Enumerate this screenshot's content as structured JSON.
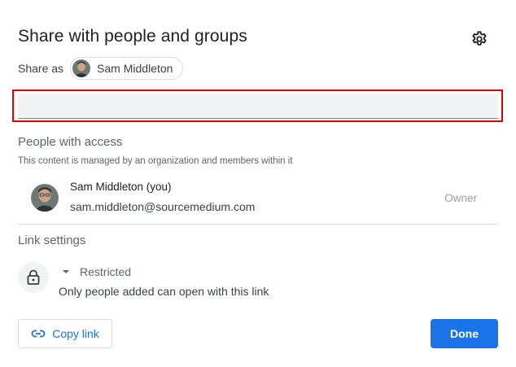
{
  "dialog": {
    "title": "Share with people and groups",
    "settings_icon": "gear-icon"
  },
  "share_as": {
    "label": "Share as",
    "account_name": "Sam Middleton"
  },
  "add_people_input": {
    "value": "",
    "placeholder": ""
  },
  "people_with_access": {
    "heading": "People with access",
    "subtext": "This content is managed by an organization and members within it",
    "people": [
      {
        "name": "Sam Middleton (you)",
        "email": "sam.middleton@sourcemedium.com",
        "role": "Owner"
      }
    ]
  },
  "link_settings": {
    "heading": "Link settings",
    "icon": "lock-icon",
    "access_level": "Restricted",
    "description": "Only people added can open with this link"
  },
  "footer": {
    "copy_link_label": "Copy link",
    "copy_link_icon": "link-icon",
    "done_label": "Done"
  },
  "colors": {
    "accent": "#1a73e8",
    "highlight_border": "#e00000"
  }
}
